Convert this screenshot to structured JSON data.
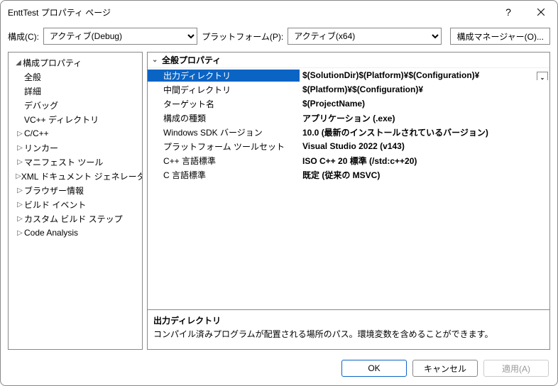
{
  "window": {
    "title": "EnttTest プロパティ ページ"
  },
  "toolbar": {
    "config_label": "構成(C):",
    "config_value": "アクティブ(Debug)",
    "platform_label": "プラットフォーム(P):",
    "platform_value": "アクティブ(x64)",
    "config_manager": "構成マネージャー(O)..."
  },
  "sidebar": {
    "root": "構成プロパティ",
    "items": [
      {
        "label": "全般",
        "expandable": false,
        "selected": true
      },
      {
        "label": "詳細",
        "expandable": false
      },
      {
        "label": "デバッグ",
        "expandable": false
      },
      {
        "label": "VC++ ディレクトリ",
        "expandable": false
      },
      {
        "label": "C/C++",
        "expandable": true
      },
      {
        "label": "リンカー",
        "expandable": true
      },
      {
        "label": "マニフェスト ツール",
        "expandable": true
      },
      {
        "label": "XML ドキュメント ジェネレーター",
        "expandable": true
      },
      {
        "label": "ブラウザー情報",
        "expandable": true
      },
      {
        "label": "ビルド イベント",
        "expandable": true
      },
      {
        "label": "カスタム ビルド ステップ",
        "expandable": true
      },
      {
        "label": "Code Analysis",
        "expandable": true
      }
    ]
  },
  "properties": {
    "group": "全般プロパティ",
    "rows": [
      {
        "label": "出力ディレクトリ",
        "value": "$(SolutionDir)$(Platform)¥$(Configuration)¥",
        "selected": true
      },
      {
        "label": "中間ディレクトリ",
        "value": "$(Platform)¥$(Configuration)¥"
      },
      {
        "label": "ターゲット名",
        "value": "$(ProjectName)"
      },
      {
        "label": "構成の種類",
        "value": "アプリケーション (.exe)"
      },
      {
        "label": "Windows SDK バージョン",
        "value": "10.0 (最新のインストールされているバージョン)"
      },
      {
        "label": "プラットフォーム ツールセット",
        "value": "Visual Studio 2022 (v143)"
      },
      {
        "label": "C++ 言語標準",
        "value": "ISO C++ 20 標準 (/std:c++20)"
      },
      {
        "label": "C 言語標準",
        "value": "既定 (従来の MSVC)"
      }
    ]
  },
  "description": {
    "title": "出力ディレクトリ",
    "text": "コンパイル済みプログラムが配置される場所のパス。環境変数を含めることができます。"
  },
  "footer": {
    "ok": "OK",
    "cancel": "キャンセル",
    "apply": "適用(A)"
  }
}
